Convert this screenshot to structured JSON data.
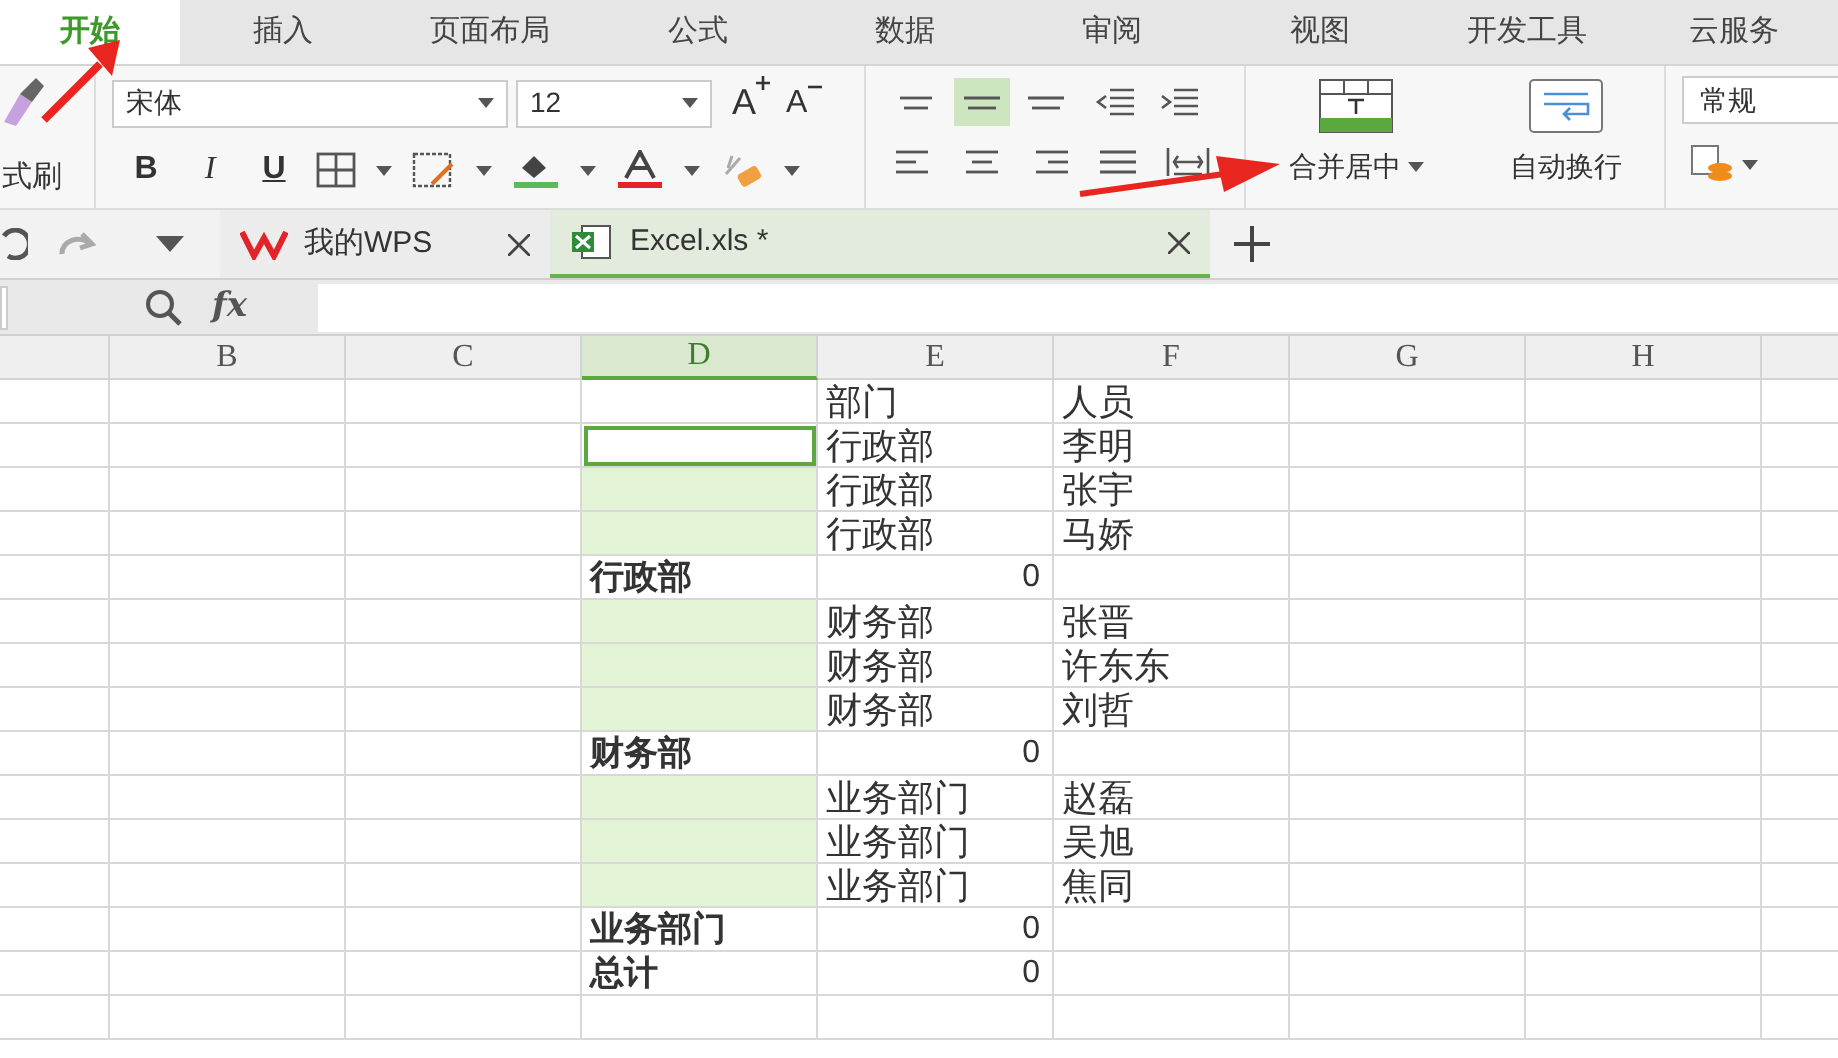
{
  "menu_tabs": [
    {
      "label": "开始",
      "selected": true
    },
    {
      "label": "插入",
      "selected": false
    },
    {
      "label": "页面布局",
      "selected": false
    },
    {
      "label": "公式",
      "selected": false
    },
    {
      "label": "数据",
      "selected": false
    },
    {
      "label": "审阅",
      "selected": false
    },
    {
      "label": "视图",
      "selected": false
    },
    {
      "label": "开发工具",
      "selected": false
    },
    {
      "label": "云服务",
      "selected": false
    }
  ],
  "ribbon": {
    "clipboard_label": "式刷",
    "font_name": "宋体",
    "font_size": "12",
    "grow_font": "A",
    "shrink_font": "A",
    "style_buttons": [
      "B",
      "I",
      "U"
    ],
    "align_top_row": [
      {
        "selected": false
      },
      {
        "selected": true
      },
      {
        "selected": false
      }
    ],
    "merge_label": "合并居中",
    "wrap_label": "自动换行",
    "number_format": "常规"
  },
  "doc_tabs": [
    {
      "title": "我的WPS",
      "selected": false
    },
    {
      "title": "Excel.xls *",
      "selected": true
    }
  ],
  "formula_bar": {
    "fx": "fx"
  },
  "columns": [
    {
      "label": "B",
      "selected": false
    },
    {
      "label": "C",
      "selected": false
    },
    {
      "label": "D",
      "selected": true
    },
    {
      "label": "E",
      "selected": false
    },
    {
      "label": "F",
      "selected": false
    },
    {
      "label": "G",
      "selected": false
    },
    {
      "label": "H",
      "selected": false
    }
  ],
  "rows": [
    {
      "d": {
        "highlighted": false,
        "selected": false
      },
      "e": {
        "text": "部门",
        "kind": "text"
      },
      "f": "人员"
    },
    {
      "d": {
        "highlighted": false,
        "selected": true
      },
      "e": {
        "text": "行政部",
        "kind": "text"
      },
      "f": "李明"
    },
    {
      "d": {
        "highlighted": true,
        "selected": false
      },
      "e": {
        "text": "行政部",
        "kind": "text"
      },
      "f": "张宇"
    },
    {
      "d": {
        "highlighted": true,
        "selected": false
      },
      "e": {
        "text": "行政部",
        "kind": "text"
      },
      "f": "马娇"
    },
    {
      "d": {
        "text": "行政部",
        "highlighted": false,
        "selected": false
      },
      "e": {
        "text": "0",
        "kind": "number"
      }
    },
    {
      "d": {
        "highlighted": true,
        "selected": false
      },
      "e": {
        "text": "财务部",
        "kind": "text"
      },
      "f": "张晋"
    },
    {
      "d": {
        "highlighted": true,
        "selected": false
      },
      "e": {
        "text": "财务部",
        "kind": "text"
      },
      "f": "许东东"
    },
    {
      "d": {
        "highlighted": true,
        "selected": false
      },
      "e": {
        "text": "财务部",
        "kind": "text"
      },
      "f": "刘哲"
    },
    {
      "d": {
        "text": "财务部",
        "highlighted": false,
        "selected": false
      },
      "e": {
        "text": "0",
        "kind": "number"
      }
    },
    {
      "d": {
        "highlighted": true,
        "selected": false
      },
      "e": {
        "text": "业务部门",
        "kind": "text"
      },
      "f": "赵磊"
    },
    {
      "d": {
        "highlighted": true,
        "selected": false
      },
      "e": {
        "text": "业务部门",
        "kind": "text"
      },
      "f": "吴旭"
    },
    {
      "d": {
        "highlighted": true,
        "selected": false
      },
      "e": {
        "text": "业务部门",
        "kind": "text"
      },
      "f": "焦同"
    },
    {
      "d": {
        "text": "业务部门",
        "highlighted": false,
        "selected": false
      },
      "e": {
        "text": "0",
        "kind": "number"
      }
    },
    {
      "d": {
        "text": "总计",
        "highlighted": false,
        "selected": false
      },
      "e": {
        "text": "0",
        "kind": "number"
      }
    }
  ]
}
